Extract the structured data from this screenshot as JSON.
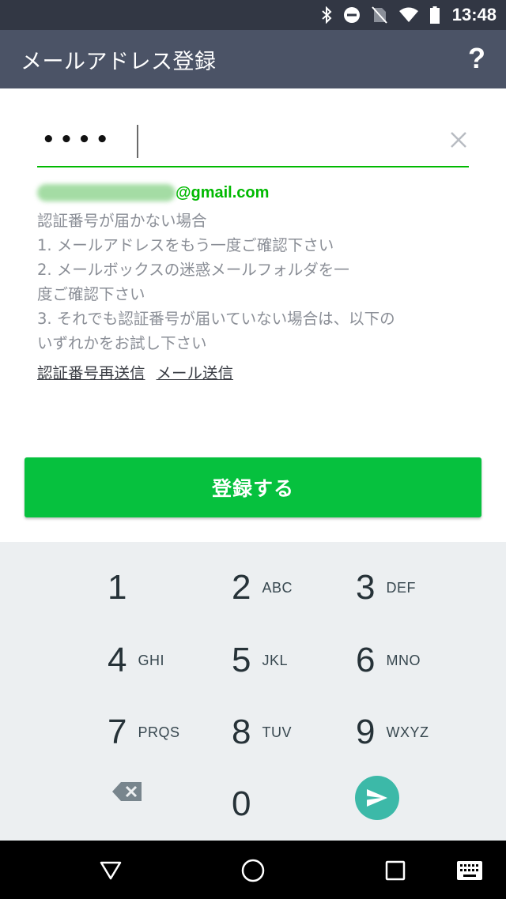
{
  "status_bar": {
    "time": "13:48",
    "icons": [
      "bluetooth-icon",
      "do-not-disturb-icon",
      "no-sim-icon",
      "wifi-icon",
      "battery-icon"
    ]
  },
  "app_bar": {
    "title": "メールアドレス登録",
    "help_label": "?"
  },
  "input": {
    "value": "••••"
  },
  "email": {
    "domain": "@gmail.com"
  },
  "help": {
    "lines": [
      "認証番号が届かない場合",
      "1. メールアドレスをもう一度ご確認下さい",
      "2. メールボックスの迷惑メールフォルダを一",
      "度ご確認下さい",
      "3. それでも認証番号が届いていない場合は、以下の",
      "いずれかをお試し下さい"
    ],
    "resend_link": "認証番号再送信",
    "mail_link": "メール送信"
  },
  "register_button": "登録する",
  "keypad": {
    "keys": [
      {
        "digit": "1",
        "letters": ""
      },
      {
        "digit": "2",
        "letters": "ABC"
      },
      {
        "digit": "3",
        "letters": "DEF"
      },
      {
        "digit": "4",
        "letters": "GHI"
      },
      {
        "digit": "5",
        "letters": "JKL"
      },
      {
        "digit": "6",
        "letters": "MNO"
      },
      {
        "digit": "7",
        "letters": "PRQS"
      },
      {
        "digit": "8",
        "letters": "TUV"
      },
      {
        "digit": "9",
        "letters": "WXYZ"
      },
      {
        "digit": "0",
        "letters": ""
      }
    ]
  },
  "colors": {
    "accent": "#00b900",
    "button": "#06c13e",
    "app_bar": "#4b5366",
    "status_bar": "#323744",
    "send": "#3cb9a8"
  }
}
